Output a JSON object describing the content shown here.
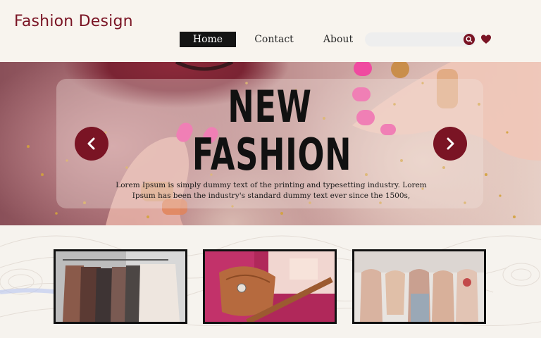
{
  "header": {
    "brand": "Fashion Design",
    "nav": [
      {
        "label": "Home",
        "active": true
      },
      {
        "label": "Contact",
        "active": false
      },
      {
        "label": "About",
        "active": false
      }
    ],
    "search": {
      "value": "",
      "placeholder": ""
    }
  },
  "hero": {
    "title_line1": "NEW",
    "title_line2": "FASHION",
    "text": "Lorem Ipsum is simply dummy text of the printing and typesetting industry. Lorem Ipsum has been the industry's standard dummy text ever since the 1500s,"
  },
  "colors": {
    "brand": "#7a1424",
    "nav_active_bg": "#141414",
    "background": "#f8f4ee",
    "accent_pink": "#f04aa0"
  },
  "icons": [
    "search-icon",
    "heart-icon",
    "chevron-left-icon",
    "chevron-right-icon"
  ],
  "gallery": [
    {
      "subject": "clothes-rack"
    },
    {
      "subject": "bag-and-belt"
    },
    {
      "subject": "mannequins"
    }
  ]
}
